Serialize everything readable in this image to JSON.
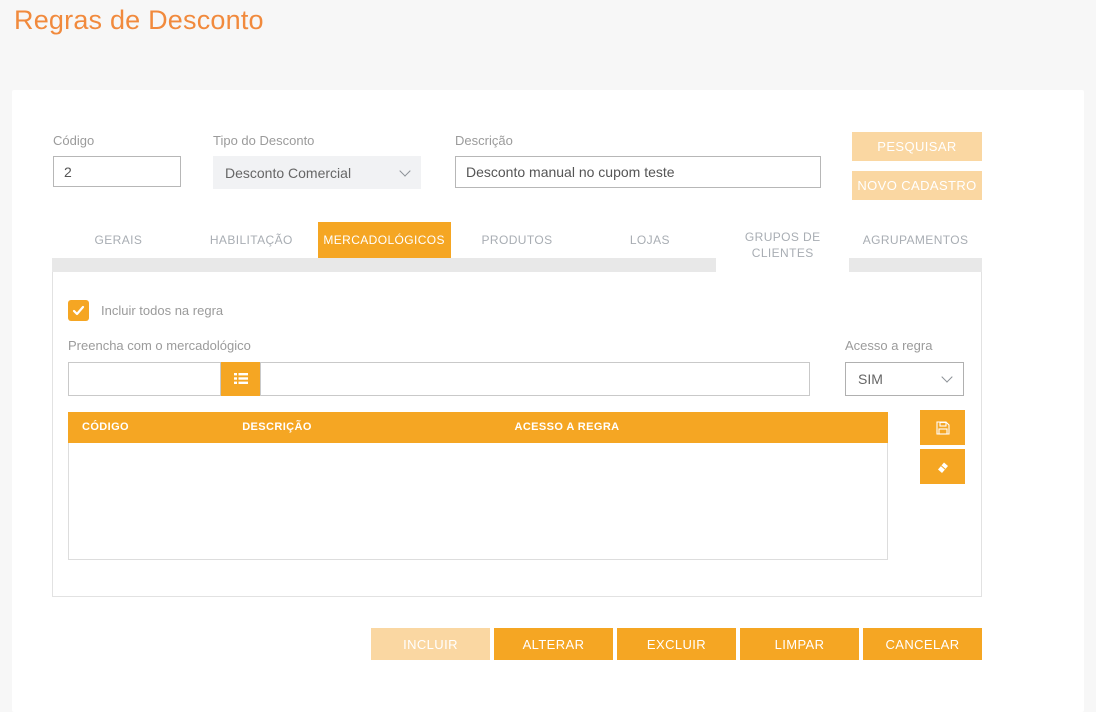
{
  "page": {
    "title": "Regras de Desconto"
  },
  "colors": {
    "accent": "#f5a623",
    "accent_disabled": "#fad7a2",
    "title": "#f18a3d",
    "label_gray": "#9b9b9b",
    "tab_inactive_text": "#a8adb3",
    "page_background": "#f7f7f7"
  },
  "form": {
    "codigo": {
      "label": "Código",
      "value": "2"
    },
    "tipo": {
      "label": "Tipo do Desconto",
      "value": "Desconto Comercial"
    },
    "descricao": {
      "label": "Descrição",
      "value": "Desconto manual no cupom teste"
    },
    "pesquisar_label": "PESQUISAR",
    "novo_cadastro_label": "NOVO CADASTRO"
  },
  "tabs": [
    {
      "label": "GERAIS"
    },
    {
      "label": "HABILITAÇÃO"
    },
    {
      "label": "MERCADOLÓGICOS",
      "active": true
    },
    {
      "label": "PRODUTOS"
    },
    {
      "label": "LOJAS"
    },
    {
      "label": "GRUPOS DE CLIENTES"
    },
    {
      "label": "AGRUPAMENTOS"
    }
  ],
  "content": {
    "include_all": {
      "label": "Incluir todos na regra",
      "checked": true
    },
    "fill_label": "Preencha com o mercadológico",
    "search_code_value": "",
    "search_description_value": "",
    "access": {
      "label": "Acesso a regra",
      "value": "SIM"
    },
    "table": {
      "headers": [
        "CÓDIGO",
        "DESCRIÇÃO",
        "ACESSO A REGRA"
      ],
      "rows": []
    }
  },
  "icons": {
    "list": "list-icon",
    "save": "floppy-disk-icon",
    "eraser": "eraser-icon",
    "chevron": "chevron-down-icon",
    "check": "check-icon"
  },
  "actions": [
    {
      "label": "INCLUIR",
      "disabled": true
    },
    {
      "label": "ALTERAR"
    },
    {
      "label": "EXCLUIR"
    },
    {
      "label": "LIMPAR"
    },
    {
      "label": "CANCELAR"
    }
  ]
}
